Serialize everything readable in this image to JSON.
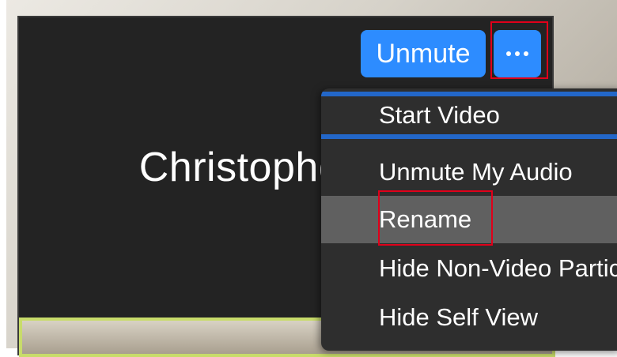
{
  "participant": {
    "name": "Christopher Lim"
  },
  "toolbar": {
    "unmute_label": "Unmute",
    "more_icon": "ellipsis-horizontal-icon"
  },
  "menu": {
    "items": [
      {
        "label": "Start Video",
        "state": "selected"
      },
      {
        "label": "Unmute My Audio",
        "state": "normal"
      },
      {
        "label": "Rename",
        "state": "hover"
      },
      {
        "label": "Hide Non-Video Participants",
        "state": "normal"
      },
      {
        "label": "Hide Self View",
        "state": "normal"
      }
    ]
  },
  "colors": {
    "accent_blue": "#2d8cff",
    "highlight_red": "#e0001a",
    "tile_background": "#232323",
    "menu_background": "#2e2e2e",
    "active_speaker_border": "#c8dc6a"
  }
}
